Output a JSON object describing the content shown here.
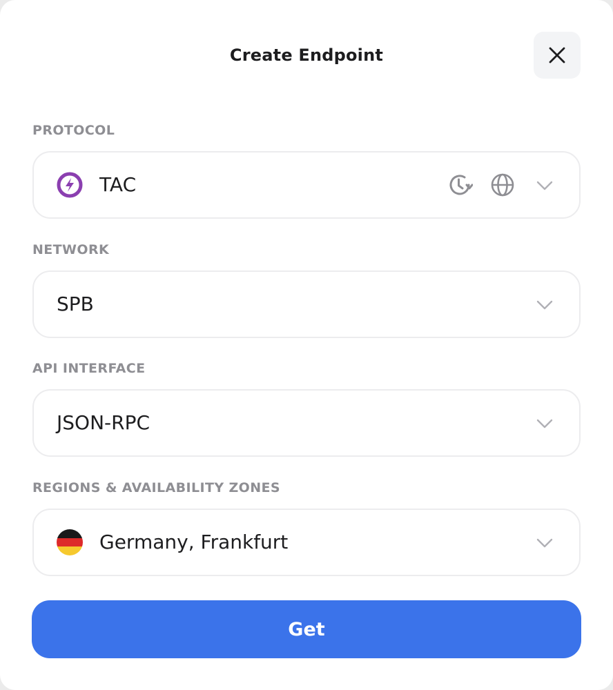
{
  "dialog": {
    "title": "Create Endpoint",
    "close_icon": "close-icon"
  },
  "fields": {
    "protocol": {
      "label": "PROTOCOL",
      "value": "TAC",
      "icon": "tac-logo-icon",
      "extra_icons": [
        "archive-history-icon",
        "globe-icon"
      ]
    },
    "network": {
      "label": "NETWORK",
      "value": "SPB"
    },
    "api_interface": {
      "label": "API INTERFACE",
      "value": "JSON-RPC"
    },
    "region": {
      "label": "REGIONS & AVAILABILITY ZONES",
      "value": "Germany, Frankfurt",
      "icon": "germany-flag-icon"
    }
  },
  "actions": {
    "get_label": "Get"
  },
  "colors": {
    "primary": "#3b73ea",
    "protocol_logo": "#8b3fb0",
    "label_gray": "#8e8e93",
    "border": "#ececee"
  }
}
